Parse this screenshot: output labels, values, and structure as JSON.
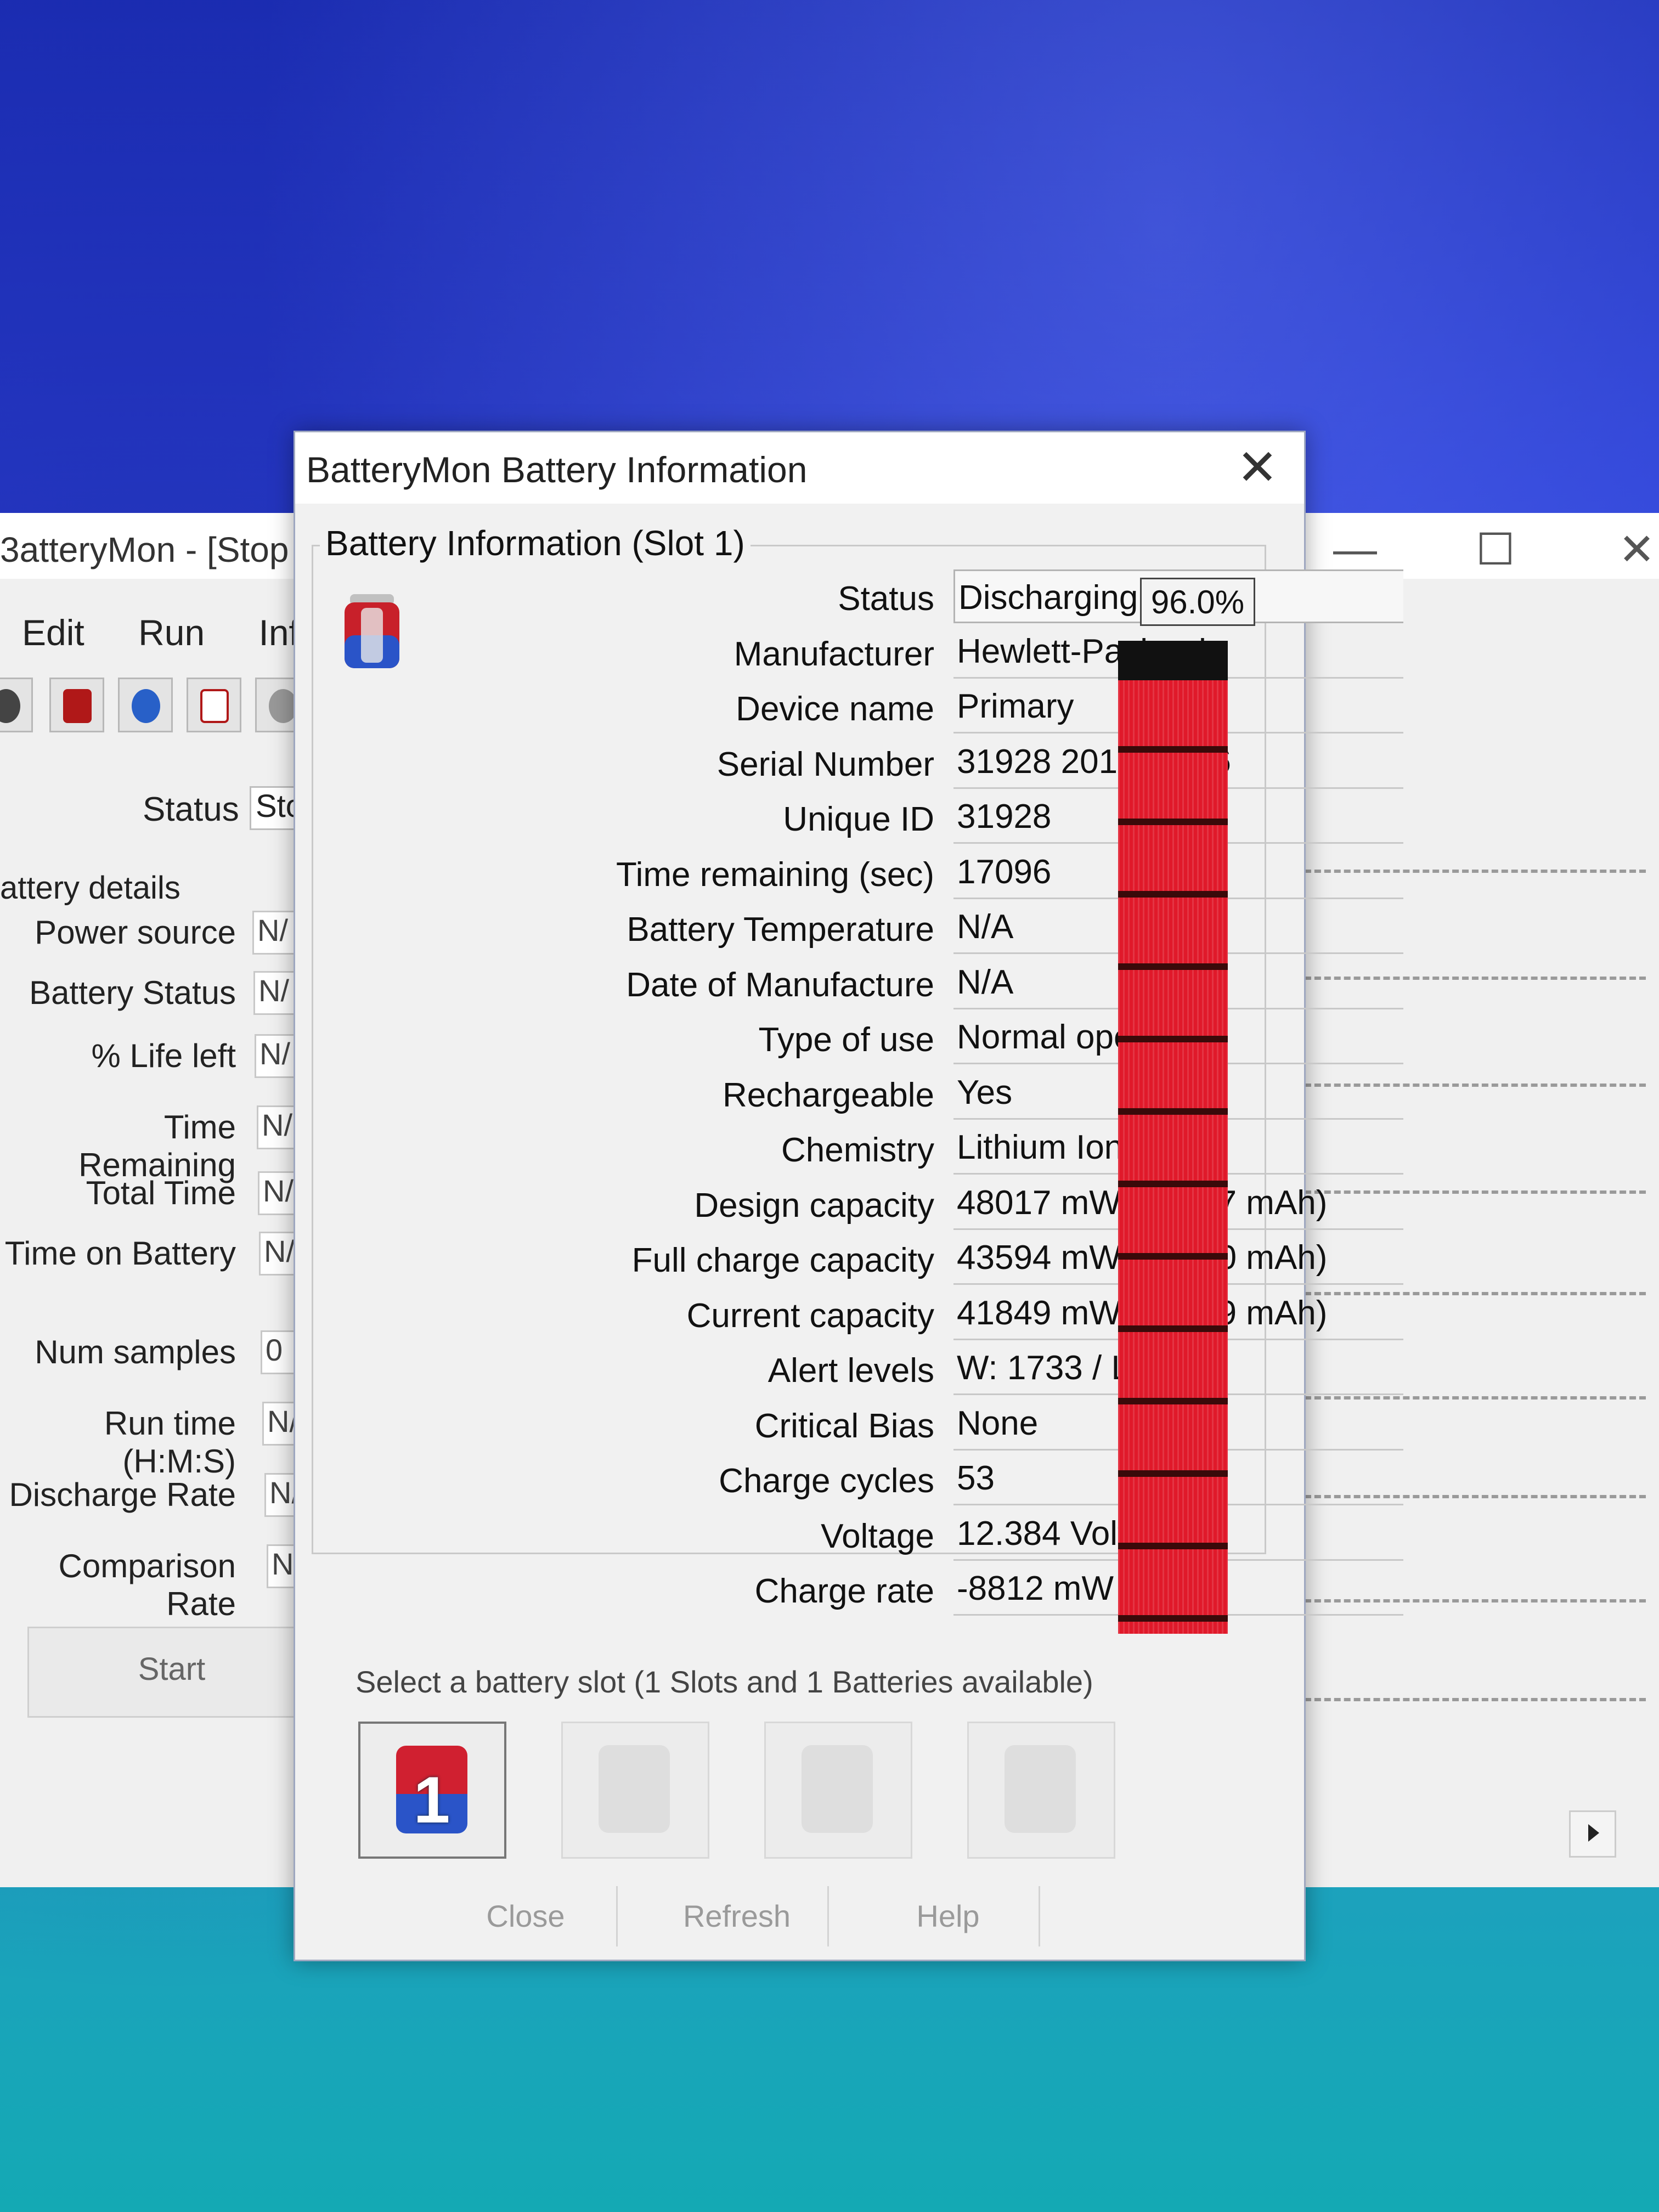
{
  "background_window": {
    "title": "3atteryMon - [Stop",
    "menu": [
      "Edit",
      "Run",
      "Info"
    ],
    "status_label": "Status",
    "status_value": "Sto",
    "group_title": "attery details",
    "rows": [
      {
        "label": "Power source",
        "value": "N/"
      },
      {
        "label": "Battery Status",
        "value": "N/"
      },
      {
        "label": "% Life left",
        "value": "N/"
      },
      {
        "label": "Time Remaining",
        "value": "N/"
      },
      {
        "label": "Total Time",
        "value": "N/"
      },
      {
        "label": "Time on Battery",
        "value": "N/"
      },
      {
        "label": "Num samples",
        "value": "0"
      },
      {
        "label": "Run time (H:M:S)",
        "value": "N/"
      },
      {
        "label": "Discharge Rate",
        "value": "N/"
      },
      {
        "label": "Comparison Rate",
        "value": "Nc"
      }
    ],
    "start_button": "Start"
  },
  "dialog": {
    "title": "BatteryMon Battery Information",
    "group_title": "Battery Information (Slot 1)",
    "charge_percent_text": "96.0%",
    "charge_fraction": 0.96,
    "fields": [
      {
        "label": "Status",
        "value": "Discharging"
      },
      {
        "label": "Manufacturer",
        "value": "Hewlett-Packard"
      },
      {
        "label": "Device name",
        "value": "Primary"
      },
      {
        "label": "Serial Number",
        "value": "31928 2017/12/06"
      },
      {
        "label": "Unique ID",
        "value": "31928"
      },
      {
        "label": "Time remaining (sec)",
        "value": "17096"
      },
      {
        "label": "Battery Temperature",
        "value": "N/A"
      },
      {
        "label": "Date of Manufacture",
        "value": "N/A"
      },
      {
        "label": "Type of use",
        "value": "Normal operation"
      },
      {
        "label": "Rechargeable",
        "value": "Yes"
      },
      {
        "label": "Chemistry",
        "value": "Lithium Ion"
      },
      {
        "label": "Design capacity",
        "value": "48017 mWh (3877 mAh)"
      },
      {
        "label": "Full charge capacity",
        "value": "43594 mWh (3520 mAh)"
      },
      {
        "label": "Current capacity",
        "value": "41849 mWh (3379 mAh)"
      },
      {
        "label": "Alert levels",
        "value": "W: 1733 / L: 4355"
      },
      {
        "label": "Critical Bias",
        "value": "None"
      },
      {
        "label": "Charge cycles",
        "value": "53"
      },
      {
        "label": "Voltage",
        "value": "12.384 Volts"
      },
      {
        "label": "Charge rate",
        "value": "-8812 mW"
      }
    ],
    "slot_select_label": "Select a battery slot (1 Slots and 1 Batteries available)",
    "slot_number": "1",
    "buttons": {
      "close": "Close",
      "refresh": "Refresh",
      "help": "Help"
    }
  },
  "colors": {
    "gauge_fill": "#e0192a",
    "gauge_empty": "#111111"
  }
}
